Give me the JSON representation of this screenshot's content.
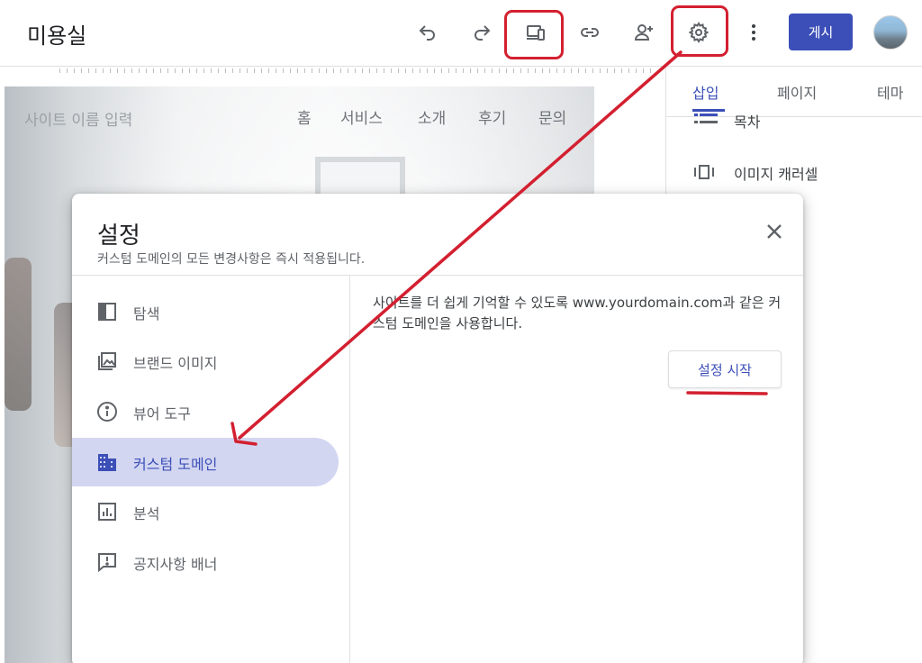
{
  "header": {
    "site_title": "미용실",
    "publish_label": "게시"
  },
  "toolbar_icons": [
    "undo-icon",
    "redo-icon",
    "preview-device-icon",
    "link-icon",
    "add-person-icon",
    "settings-gear-icon",
    "more-vert-icon"
  ],
  "canvas": {
    "site_name_placeholder": "사이트 이름 입력",
    "nav": [
      "홈",
      "서비스",
      "소개",
      "후기",
      "문의"
    ]
  },
  "right_panel": {
    "tabs": [
      "삽입",
      "페이지",
      "테마"
    ],
    "active_tab": "삽입",
    "items": [
      {
        "icon": "toc-icon",
        "label": "목차"
      },
      {
        "icon": "image-carousel-icon",
        "label": "이미지 캐러셀"
      }
    ]
  },
  "settings_dialog": {
    "title": "설정",
    "subtitle": "커스텀 도메인의 모든 변경사항은 즉시 적용됩니다.",
    "nav": [
      {
        "icon": "navigation-icon",
        "label": "탐색"
      },
      {
        "icon": "brand-image-icon",
        "label": "브랜드 이미지"
      },
      {
        "icon": "info-icon",
        "label": "뷰어 도구"
      },
      {
        "icon": "building-icon",
        "label": "커스텀 도메인"
      },
      {
        "icon": "analytics-icon",
        "label": "분석"
      },
      {
        "icon": "announcement-icon",
        "label": "공지사항 배너"
      }
    ],
    "active_nav": "커스텀 도메인",
    "description": "사이트를 더 쉽게 기억할 수 있도록 www.yourdomain.com과 같은 커스텀 도메인을 사용합니다.",
    "start_button": "설정 시작"
  },
  "colors": {
    "accent": "#3c4fb8",
    "active_nav_bg": "#d3d6f1",
    "annotation_red": "#d32030"
  }
}
